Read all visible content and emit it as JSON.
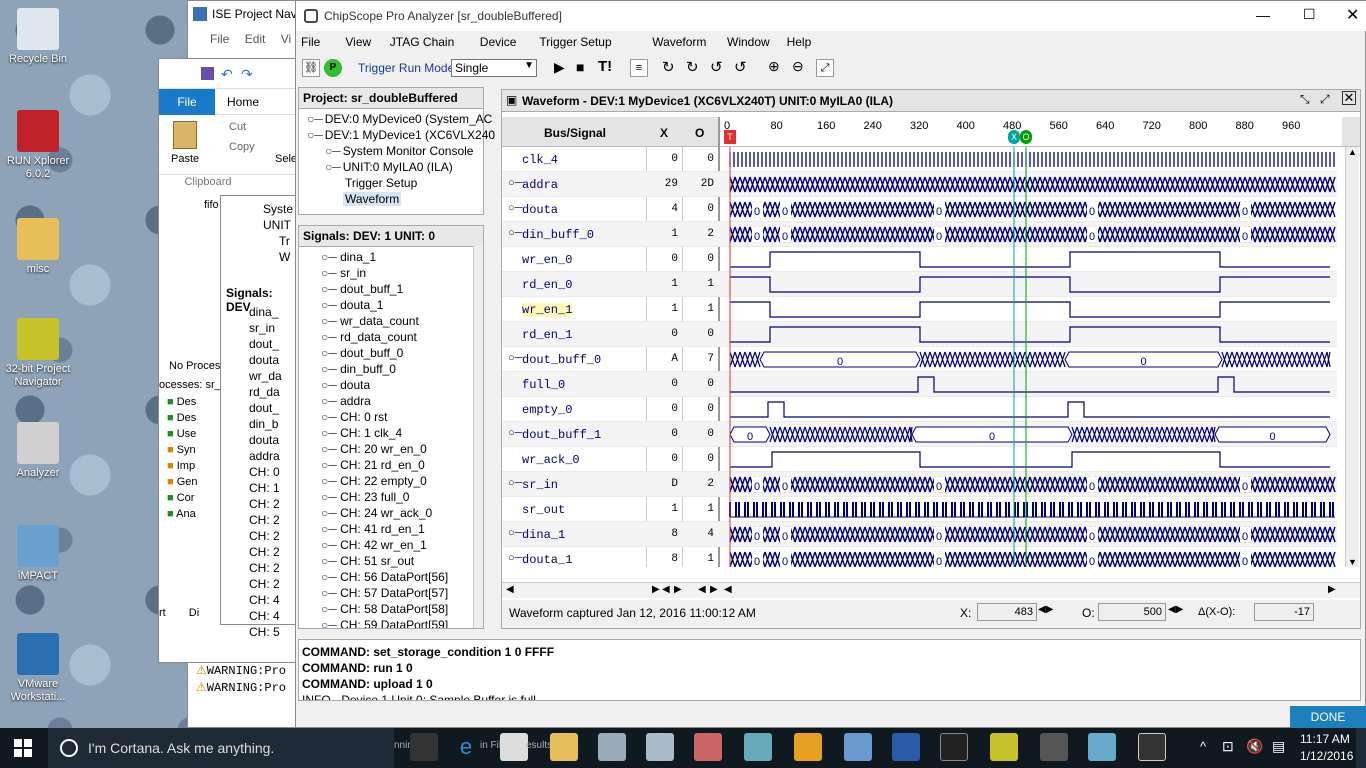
{
  "desktop": {
    "icons": [
      {
        "label": "Recycle Bin",
        "icon": "recycle-bin-icon",
        "color": "#dfe6ee"
      },
      {
        "label": "RUN Xplorer 6.0.2",
        "icon": "xplorer-icon",
        "color": "#c0222a"
      },
      {
        "label": "misc",
        "icon": "folder-icon",
        "color": "#e8c05a"
      },
      {
        "label": "32-bit Project Navigator",
        "icon": "project-navigator-icon",
        "color": "#c7c32a"
      },
      {
        "label": "Analyzer",
        "icon": "analyzer-icon",
        "color": "#d0d0d0"
      },
      {
        "label": "iMPACT",
        "icon": "impact-icon",
        "color": "#6aa0d0"
      },
      {
        "label": "VMware Workstati...",
        "icon": "vmware-icon",
        "color": "#2a6fb0"
      }
    ]
  },
  "ise": {
    "title": "ISE Project Navi",
    "menu": [
      "File",
      "Edit",
      "Vi"
    ],
    "ribbon_tabs": [
      "File",
      "Home"
    ],
    "paste": "Paste",
    "cut": "Cut",
    "copy": "Copy",
    "select": "Sele",
    "clipboard": "Clipboard",
    "tree": [
      "Syste",
      "UNIT",
      "Tr",
      "W"
    ],
    "signals_title": "Signals: DEV",
    "signals": [
      "dina_",
      "sr_in",
      "dout_",
      "douta",
      "wr_da",
      "rd_da",
      "dout_",
      "din_b",
      "douta",
      "addra",
      "CH: 0",
      "CH: 1",
      "CH: 2",
      "CH: 2",
      "CH: 2",
      "CH: 2",
      "CH: 2",
      "CH: 2",
      "CH: 4",
      "CH: 4",
      "CH: 5"
    ],
    "no_process": "No Proces",
    "processes": "ocesses: sr_c",
    "proc_items": [
      "Des",
      "Des",
      "Use",
      "Syn",
      "Imp",
      "Gen",
      "Cor",
      "Ana"
    ],
    "bottom_tabs": [
      "rt",
      "Di"
    ],
    "file_item": "fifo",
    "warnings": [
      "WARNING:Pro",
      "WARNING:Pro"
    ]
  },
  "chipscope": {
    "title": "ChipScope Pro Analyzer [sr_doubleBuffered]",
    "menu": [
      "File",
      "View",
      "JTAG Chain",
      "Device",
      "Trigger Setup",
      "Waveform",
      "Window",
      "Help"
    ],
    "trigger_run_mode_label": "Trigger Run Mode:",
    "trigger_run_mode": "Single",
    "project_title": "Project: sr_doubleBuffered",
    "project_tree": [
      {
        "label": "DEV:0 MyDevice0 (System_AC",
        "indent": 0
      },
      {
        "label": "DEV:1 MyDevice1 (XC6VLX240",
        "indent": 0
      },
      {
        "label": "System Monitor Console",
        "indent": 1
      },
      {
        "label": "UNIT:0 MyILA0 (ILA)",
        "indent": 1
      },
      {
        "label": "Trigger Setup",
        "indent": 2
      },
      {
        "label": "Waveform",
        "indent": 2
      }
    ],
    "signals_title": "Signals: DEV: 1 UNIT: 0",
    "signals": [
      "dina_1",
      "sr_in",
      "dout_buff_1",
      "douta_1",
      "wr_data_count",
      "rd_data_count",
      "dout_buff_0",
      "din_buff_0",
      "douta",
      "addra",
      "CH: 0 rst",
      "CH: 1 clk_4",
      "CH: 20 wr_en_0",
      "CH: 21 rd_en_0",
      "CH: 22 empty_0",
      "CH: 23 full_0",
      "CH: 24 wr_ack_0",
      "CH: 41 rd_en_1",
      "CH: 42 wr_en_1",
      "CH: 51 sr_out",
      "CH: 56 DataPort[56]",
      "CH: 57 DataPort[57]",
      "CH: 58 DataPort[58]",
      "CH: 59 DataPort[59]"
    ],
    "waveform_title": "Waveform - DEV:1 MyDevice1 (XC6VLX240T) UNIT:0 MyILA0 (ILA)",
    "col_bus": "Bus/Signal",
    "col_x": "X",
    "col_o": "O",
    "ticks": [
      "0",
      "80",
      "160",
      "240",
      "320",
      "400",
      "480",
      "560",
      "640",
      "720",
      "800",
      "880",
      "960"
    ],
    "cursor_x_tag": "X",
    "cursor_o_tag": "O",
    "trigger_tag": "T",
    "rows": [
      {
        "name": "clk_4",
        "x": "0",
        "o": "0",
        "bus": false,
        "kind": "clock"
      },
      {
        "name": "addra",
        "x": "29",
        "o": "2D",
        "bus": true,
        "kind": "busdense"
      },
      {
        "name": "douta",
        "x": "4",
        "o": "0",
        "bus": true,
        "kind": "busdense0"
      },
      {
        "name": "din_buff_0",
        "x": "1",
        "o": "2",
        "bus": true,
        "kind": "busdense0"
      },
      {
        "name": "wr_en_0",
        "x": "0",
        "o": "0",
        "bus": false,
        "kind": "pulse",
        "edges": [
          0,
          40,
          190,
          340,
          490,
          600
        ],
        "start": 0
      },
      {
        "name": "rd_en_0",
        "x": "1",
        "o": "1",
        "bus": false,
        "kind": "pulse",
        "edges": [
          0,
          40,
          190,
          340,
          490,
          600
        ],
        "start": 1
      },
      {
        "name": "wr_en_1",
        "x": "1",
        "o": "1",
        "bus": false,
        "kind": "pulse",
        "edges": [
          0,
          40,
          190,
          340,
          490,
          600
        ],
        "start": 1,
        "highlight": true
      },
      {
        "name": "rd_en_1",
        "x": "0",
        "o": "0",
        "bus": false,
        "kind": "pulse",
        "edges": [
          0,
          40,
          190,
          340,
          490,
          600
        ],
        "start": 0
      },
      {
        "name": "dout_buff_0",
        "x": "A",
        "o": "7",
        "bus": true,
        "kind": "busseg",
        "segs": [
          [
            0,
            30,
            "x"
          ],
          [
            30,
            190,
            "0"
          ],
          [
            190,
            335,
            "x"
          ],
          [
            335,
            492,
            "0"
          ],
          [
            492,
            600,
            "x"
          ]
        ]
      },
      {
        "name": "full_0",
        "x": "0",
        "o": "0",
        "bus": false,
        "kind": "pulse",
        "edges": [
          0,
          188,
          204,
          488,
          504,
          600
        ],
        "start": 0
      },
      {
        "name": "empty_0",
        "x": "0",
        "o": "0",
        "bus": false,
        "kind": "pulse",
        "edges": [
          0,
          38,
          54,
          338,
          354,
          600
        ],
        "start": 0
      },
      {
        "name": "dout_buff_1",
        "x": "0",
        "o": "0",
        "bus": true,
        "kind": "busseg",
        "segs": [
          [
            0,
            40,
            "0"
          ],
          [
            40,
            182,
            "x"
          ],
          [
            182,
            342,
            "0"
          ],
          [
            342,
            485,
            "x"
          ],
          [
            485,
            600,
            "0"
          ]
        ]
      },
      {
        "name": "wr_ack_0",
        "x": "0",
        "o": "0",
        "bus": false,
        "kind": "pulse",
        "edges": [
          0,
          42,
          190,
          342,
          490,
          600
        ],
        "start": 0
      },
      {
        "name": "sr_in",
        "x": "D",
        "o": "2",
        "bus": true,
        "kind": "busdense0"
      },
      {
        "name": "sr_out",
        "x": "1",
        "o": "1",
        "bus": false,
        "kind": "random"
      },
      {
        "name": "dina_1",
        "x": "8",
        "o": "4",
        "bus": true,
        "kind": "busdense0"
      },
      {
        "name": "douta_1",
        "x": "8",
        "o": "1",
        "bus": true,
        "kind": "busdense0"
      }
    ],
    "status": "Waveform captured Jan 12, 2016 11:00:12 AM",
    "x_label": "X:",
    "x_value": "483",
    "o_label": "O:",
    "o_value": "500",
    "delta_label": "Δ(X-O):",
    "delta_value": "-17",
    "console": [
      "COMMAND: set_storage_condition 1 0 FFFF",
      "COMMAND: run 1 0",
      "COMMAND: upload 1 0",
      "INFO - Device 1 Unit 0:  Sample Buffer is full"
    ],
    "done": "DONE",
    "colors": {
      "wave": "#00007a",
      "cursor_x": "#00a0a0",
      "cursor_o": "#00a000",
      "trigger": "#e03030",
      "done": "#1e7fbf"
    }
  },
  "taskbar": {
    "search": "I'm Cortana. Ask me anything.",
    "time": "11:17 AM",
    "date": "1/12/2016",
    "partial": "nnin",
    "partial2": "in File",
    "partial3": "esults"
  }
}
